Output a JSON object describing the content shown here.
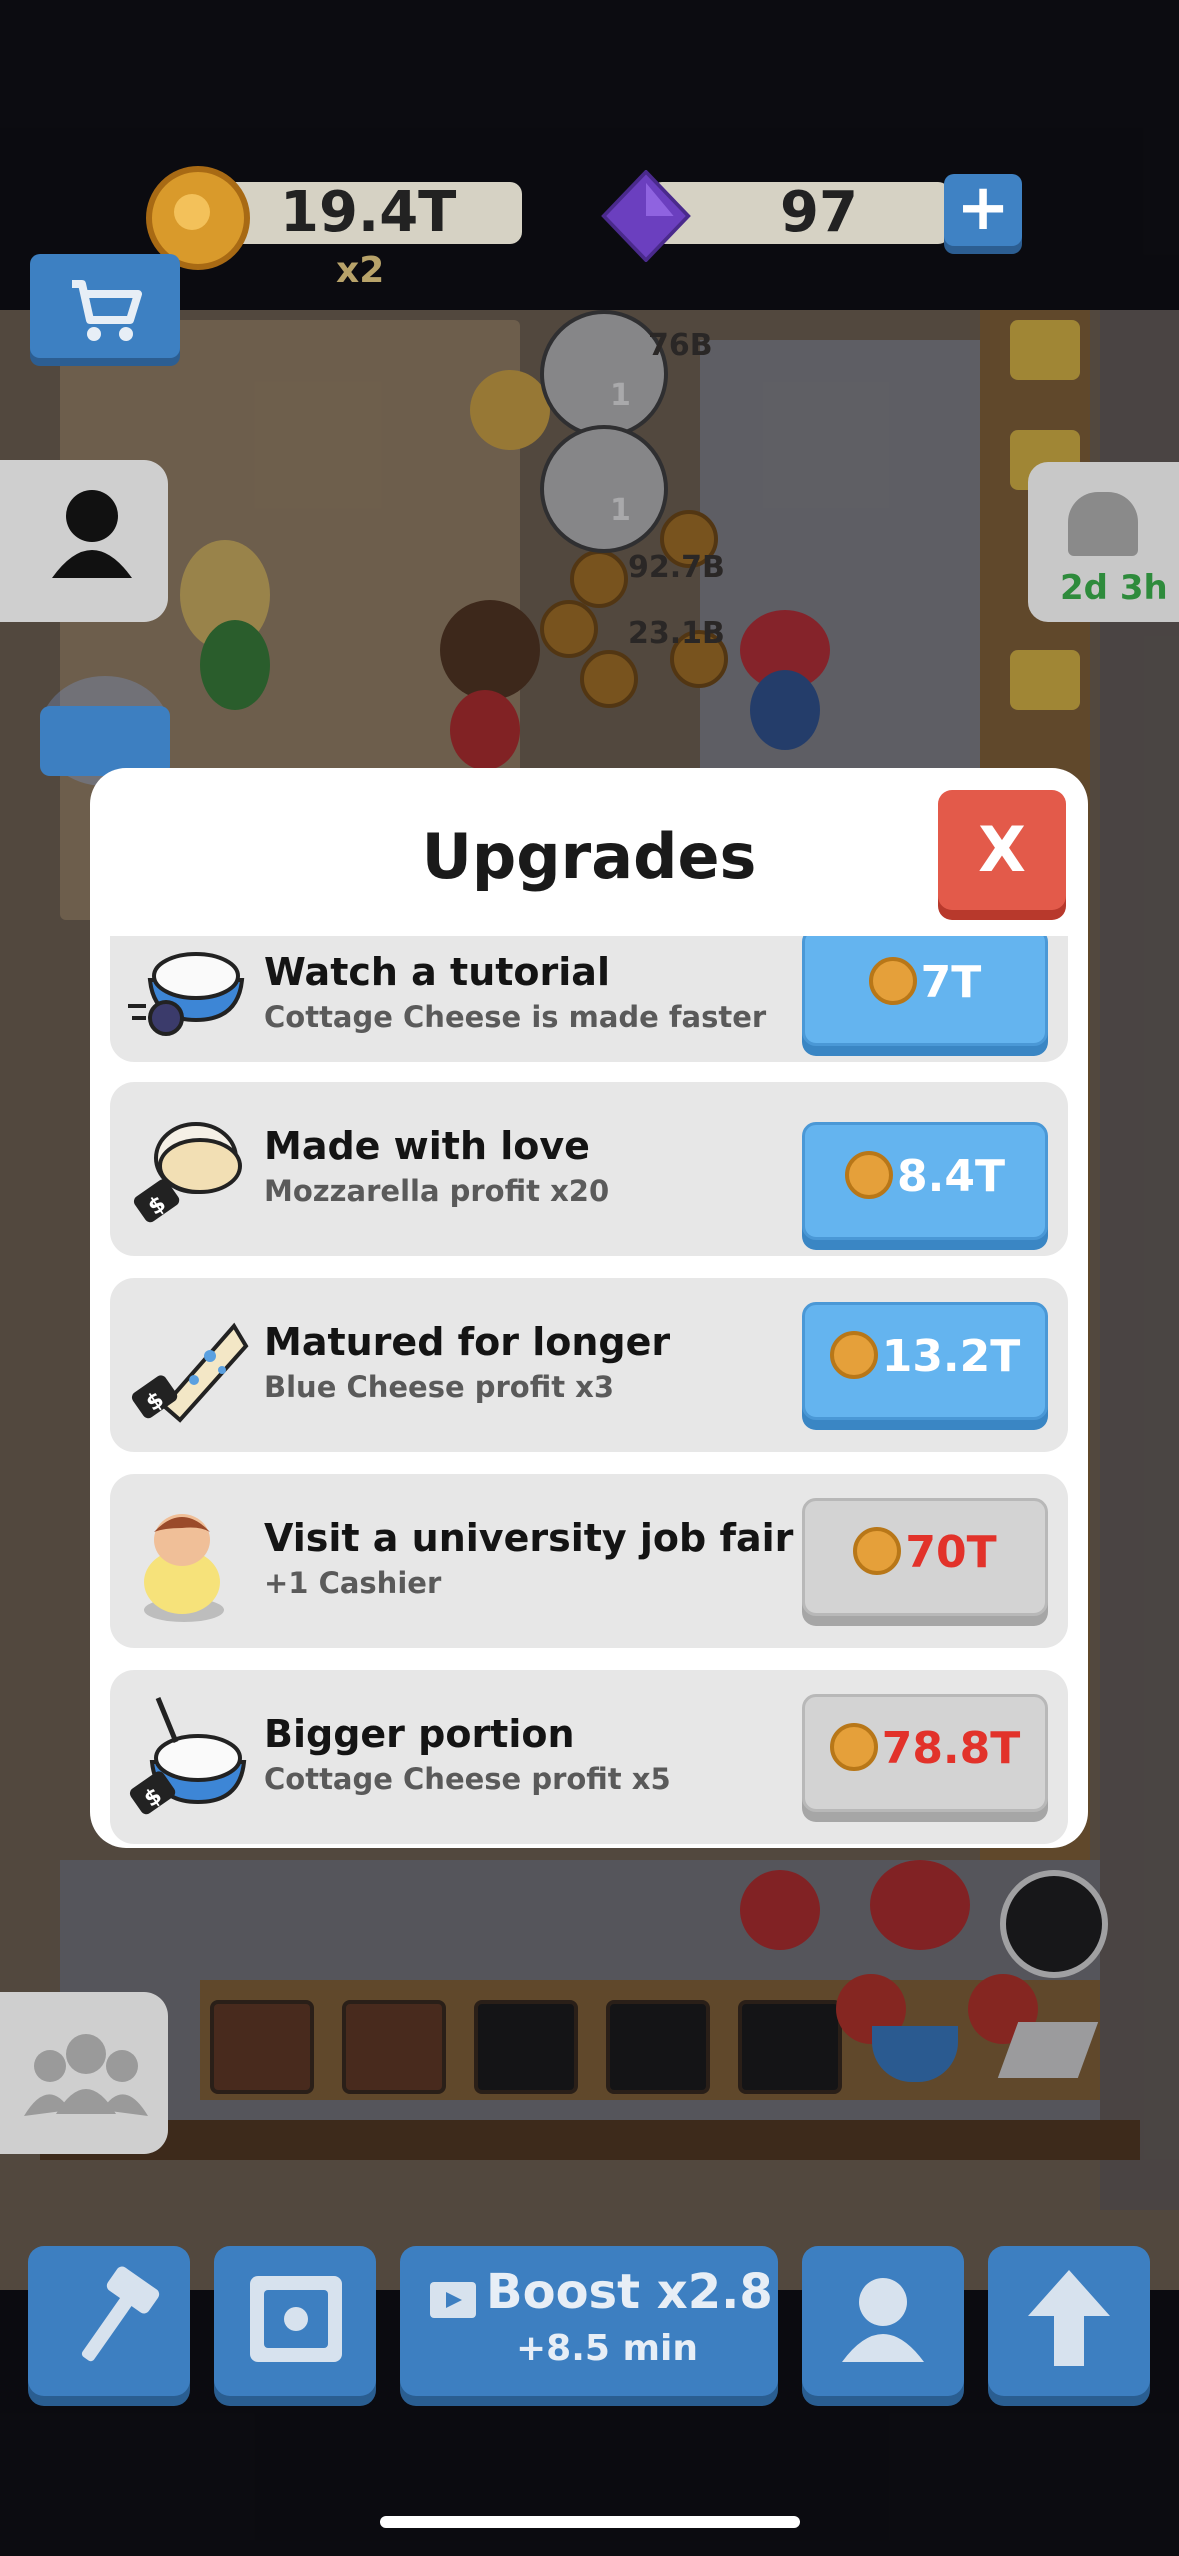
{
  "hud": {
    "coins": "19.4T",
    "multiplier": "x2",
    "gems": "97",
    "timer": "2d 3h"
  },
  "scene_labels": [
    "76B",
    "92.7B",
    "23.1B",
    "1",
    "1"
  ],
  "modal": {
    "title": "Upgrades",
    "close_label": "X",
    "items": [
      {
        "title": "Watch a tutorial",
        "desc": "Cottage Cheese is made faster",
        "price": "7T",
        "affordable": true
      },
      {
        "title": "Made with love",
        "desc": "Mozzarella profit x20",
        "price": "8.4T",
        "affordable": true
      },
      {
        "title": "Matured for longer",
        "desc": "Blue Cheese profit x3",
        "price": "13.2T",
        "affordable": true
      },
      {
        "title": "Visit a university job fair",
        "desc": "+1 Cashier",
        "price": "70T",
        "affordable": false
      },
      {
        "title": "Bigger portion",
        "desc": "Cottage Cheese profit x5",
        "price": "78.8T",
        "affordable": false
      }
    ]
  },
  "bottom_bar": {
    "boost_title": "Boost x2.8",
    "boost_sub": "+8.5 min",
    "icons": [
      "hammer-icon",
      "vault-icon",
      "video-icon",
      "person-icon",
      "upgrade-arrow-icon"
    ]
  },
  "colors": {
    "button_blue": "#64b4ef",
    "button_gray": "#d3d3d3",
    "price_red": "#e2322a",
    "close_red": "#e35a4a"
  }
}
